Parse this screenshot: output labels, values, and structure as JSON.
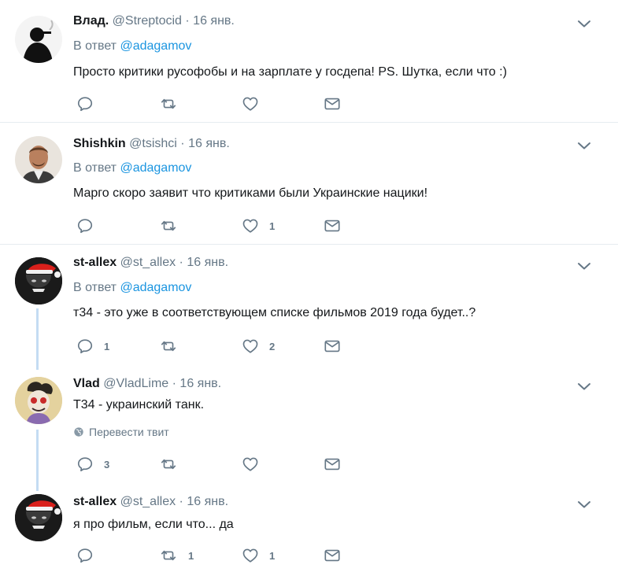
{
  "tweets": [
    {
      "name": "Влад.",
      "handle": "@Streptocid",
      "date": "· 16 янв.",
      "reply_prefix": "В ответ",
      "reply_to": "@adagamov",
      "text": "Просто критики русофобы и на зарплате у госдепа! PS. Шутка, если что :)",
      "replies": "",
      "retweets": "",
      "likes": ""
    },
    {
      "name": "Shishkin",
      "handle": "@tsishci",
      "date": "· 16 янв.",
      "reply_prefix": "В ответ",
      "reply_to": "@adagamov",
      "text": "Марго скоро заявит что критиками были Украинские нацики!",
      "replies": "",
      "retweets": "",
      "likes": "1"
    },
    {
      "name": "st-allex",
      "handle": "@st_allex",
      "date": "· 16 янв.",
      "reply_prefix": "В ответ",
      "reply_to": "@adagamov",
      "text": "т34 - это уже в соответствующем списке фильмов 2019 года будет..?",
      "replies": "1",
      "retweets": "",
      "likes": "2"
    },
    {
      "name": "Vlad",
      "handle": "@VladLime",
      "date": "· 16 янв.",
      "text": "Т34 - украинский танк.",
      "translate": "Перевести твит",
      "replies": "3",
      "retweets": "",
      "likes": ""
    },
    {
      "name": "st-allex",
      "handle": "@st_allex",
      "date": "· 16 янв.",
      "text": "я про фильм, если что... да",
      "replies": "",
      "retweets": "1",
      "likes": "1"
    }
  ],
  "icons": {
    "reply": "reply-icon",
    "retweet": "retweet-icon",
    "like": "like-icon",
    "dm": "direct-message-icon",
    "caret": "chevron-down-icon",
    "globe": "globe-icon"
  },
  "colors": {
    "text": "#14171a",
    "secondary": "#657786",
    "link": "#1b95e0",
    "separator": "#e6ecf0",
    "thread_line": "#c4dcf3"
  }
}
